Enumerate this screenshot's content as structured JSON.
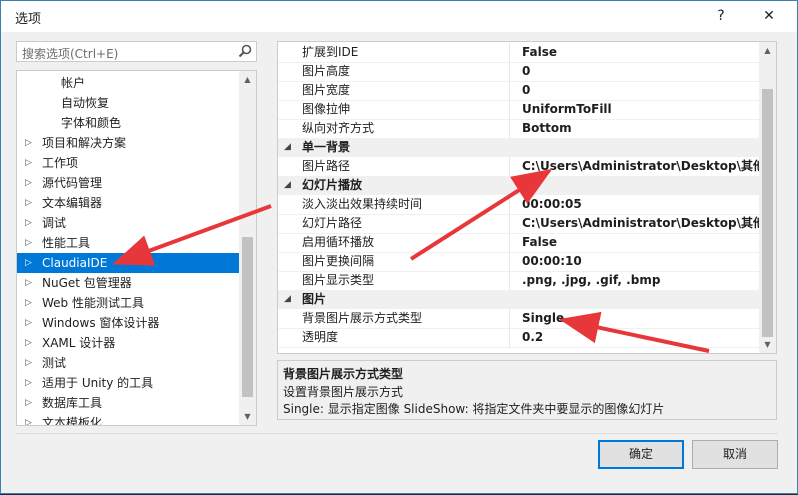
{
  "window": {
    "title": "选项",
    "help_label": "?",
    "close_label": "✕"
  },
  "search": {
    "placeholder": "搜索选项(Ctrl+E)"
  },
  "tree": {
    "items": [
      {
        "label": "帐户",
        "level": 2,
        "expandable": false
      },
      {
        "label": "自动恢复",
        "level": 2,
        "expandable": false
      },
      {
        "label": "字体和颜色",
        "level": 2,
        "expandable": false
      },
      {
        "label": "项目和解决方案",
        "level": 1,
        "expandable": true
      },
      {
        "label": "工作项",
        "level": 1,
        "expandable": true
      },
      {
        "label": "源代码管理",
        "level": 1,
        "expandable": true
      },
      {
        "label": "文本编辑器",
        "level": 1,
        "expandable": true
      },
      {
        "label": "调试",
        "level": 1,
        "expandable": true
      },
      {
        "label": "性能工具",
        "level": 1,
        "expandable": true
      },
      {
        "label": "ClaudiaIDE",
        "level": 1,
        "expandable": true,
        "selected": true
      },
      {
        "label": "NuGet 包管理器",
        "level": 1,
        "expandable": true
      },
      {
        "label": "Web 性能测试工具",
        "level": 1,
        "expandable": true
      },
      {
        "label": "Windows 窗体设计器",
        "level": 1,
        "expandable": true
      },
      {
        "label": "XAML 设计器",
        "level": 1,
        "expandable": true
      },
      {
        "label": "测试",
        "level": 1,
        "expandable": true
      },
      {
        "label": "适用于 Unity 的工具",
        "level": 1,
        "expandable": true
      },
      {
        "label": "数据库工具",
        "level": 1,
        "expandable": true
      },
      {
        "label": "文本模板化",
        "level": 1,
        "expandable": true
      }
    ]
  },
  "properties": [
    {
      "type": "prop",
      "name": "扩展到IDE",
      "value": "False"
    },
    {
      "type": "prop",
      "name": "图片高度",
      "value": "0"
    },
    {
      "type": "prop",
      "name": "图片宽度",
      "value": "0"
    },
    {
      "type": "prop",
      "name": "图像拉伸",
      "value": "UniformToFill"
    },
    {
      "type": "prop",
      "name": "纵向对齐方式",
      "value": "Bottom"
    },
    {
      "type": "cat",
      "name": "单一背景"
    },
    {
      "type": "prop",
      "name": "图片路径",
      "value": "C:\\Users\\Administrator\\Desktop\\其他\\"
    },
    {
      "type": "cat",
      "name": "幻灯片播放"
    },
    {
      "type": "prop",
      "name": "淡入淡出效果持续时间",
      "value": "00:00:05"
    },
    {
      "type": "prop",
      "name": "幻灯片路径",
      "value": "C:\\Users\\Administrator\\Desktop\\其他\\"
    },
    {
      "type": "prop",
      "name": "启用循环播放",
      "value": "False"
    },
    {
      "type": "prop",
      "name": "图片更换间隔",
      "value": "00:00:10"
    },
    {
      "type": "prop",
      "name": "图片显示类型",
      "value": ".png, .jpg, .gif, .bmp"
    },
    {
      "type": "cat",
      "name": "图片"
    },
    {
      "type": "prop",
      "name": "背景图片展示方式类型",
      "value": "Single"
    },
    {
      "type": "prop",
      "name": "透明度",
      "value": "0.2"
    }
  ],
  "description": {
    "title": "背景图片展示方式类型",
    "line1": "设置背景图片展示方式",
    "line2": "Single: 显示指定图像 SlideShow: 将指定文件夹中要显示的图像幻灯片"
  },
  "buttons": {
    "ok": "确定",
    "cancel": "取消"
  },
  "colors": {
    "selection": "#0078d7",
    "annotation_arrow": "#e8373a"
  }
}
